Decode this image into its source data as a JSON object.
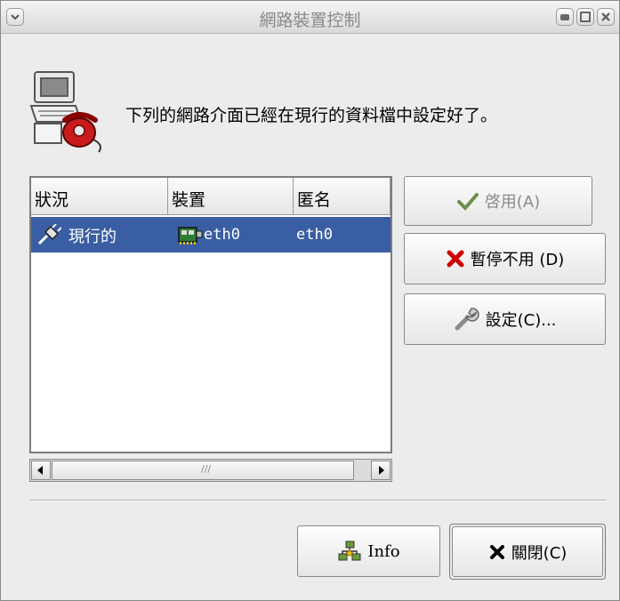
{
  "window": {
    "title": "網路裝置控制",
    "message": "下列的網路介面已經在現行的資料檔中設定好了。"
  },
  "table": {
    "columns": [
      "狀況",
      "裝置",
      "匿名"
    ],
    "rows": [
      {
        "status": "現行的",
        "device": "eth0",
        "nickname": "eth0",
        "selected": true
      }
    ],
    "scroll_grip": "///"
  },
  "buttons": {
    "activate": "啓用(A)",
    "deactivate": "暫停不用 (D)",
    "configure": "設定(C)...",
    "info": "Info",
    "close": "關閉(C)"
  },
  "colors": {
    "selection": "#3a5ea3",
    "window_bg": "#ececec"
  },
  "icons": {
    "window_menu": "chevron-down-icon",
    "minimize": "minimize-icon",
    "maximize": "maximize-icon",
    "close": "close-icon",
    "header": "computer-phone-icon",
    "status_active": "plug-connected-icon",
    "device": "network-card-icon",
    "activate": "checkmark-icon",
    "deactivate": "red-x-icon",
    "configure": "wrench-icon",
    "info": "network-stars-icon",
    "close_button": "black-x-icon"
  }
}
